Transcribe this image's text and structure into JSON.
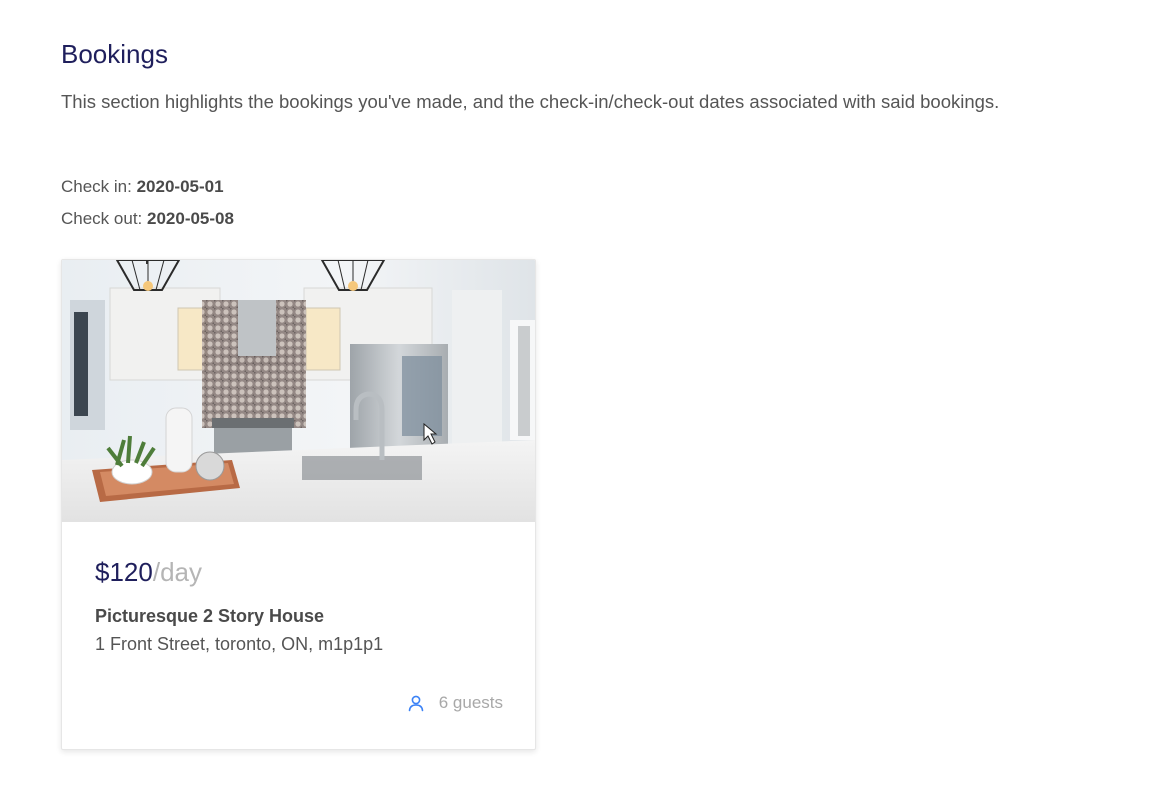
{
  "page": {
    "title": "Bookings",
    "description": "This section highlights the bookings you've made, and the check-in/check-out dates associated with said bookings."
  },
  "booking": {
    "check_in_label": "Check in: ",
    "check_in_value": "2020-05-01",
    "check_out_label": "Check out: ",
    "check_out_value": "2020-05-08"
  },
  "listing": {
    "image_alt": "Kitchen interior photo",
    "price": "$120",
    "price_unit": "/day",
    "title": "Picturesque 2 Story House",
    "address": "1 Front Street, toronto, ON, m1p1p1",
    "guests": "6 guests",
    "guest_icon": "user-icon"
  },
  "colors": {
    "title": "#1f1f5c",
    "price": "#1f1f5c",
    "muted": "#b5b5b5",
    "icon_accent": "#3b82f6"
  }
}
